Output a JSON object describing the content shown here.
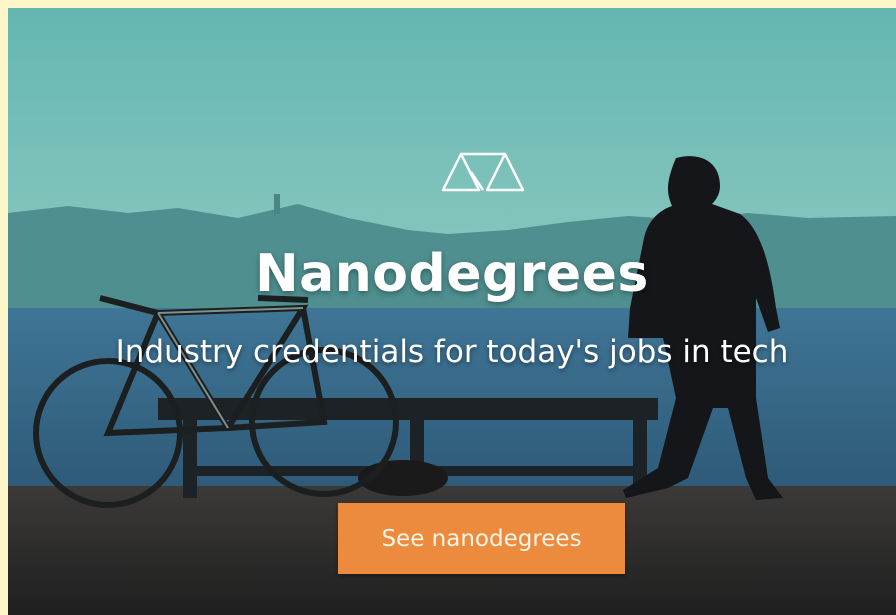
{
  "hero": {
    "logo_icon": "nanodegree-scales-icon",
    "title": "Nanodegrees",
    "subtitle": "Industry credentials for today's jobs in tech",
    "cta_label": "See nanodegrees"
  },
  "colors": {
    "sky": "#6fb9b3",
    "water": "#3a6f8f",
    "cta": "#ec8b3e",
    "page_border": "#fdf6c8"
  }
}
